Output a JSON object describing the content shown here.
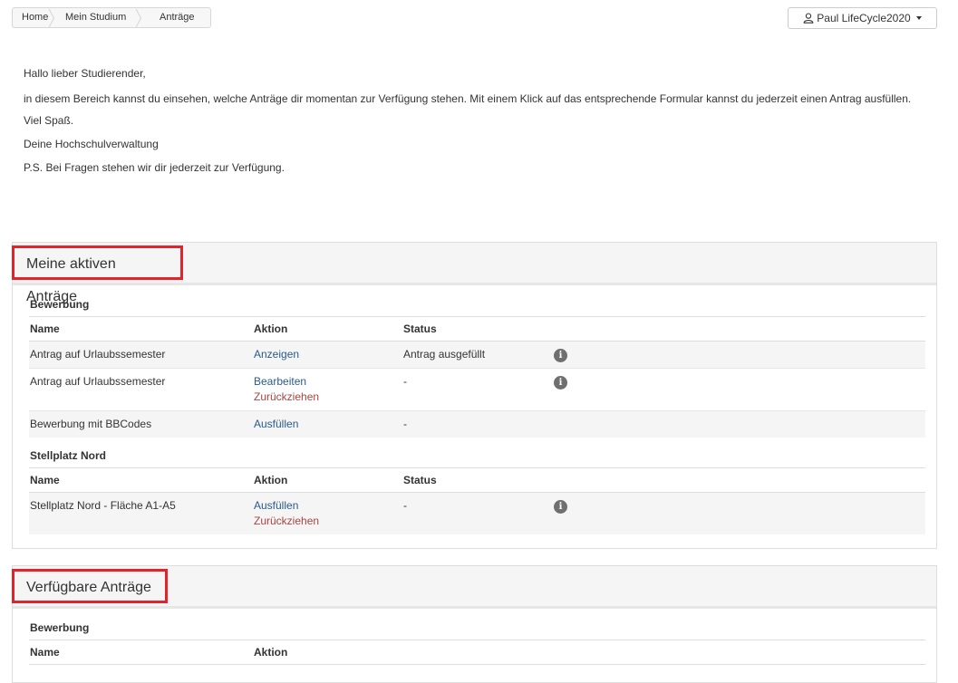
{
  "breadcrumb": [
    "Home",
    "Mein Studium",
    "Anträge"
  ],
  "user": {
    "name": "Paul LifeCycle2020",
    "icon": "user-icon"
  },
  "intro": {
    "greeting": "Hallo lieber Studierender,",
    "body": "in diesem Bereich kannst du einsehen, welche Anträge dir momentan zur Verfügung stehen. Mit einem Klick auf das entsprechende Formular kannst du jederzeit einen Antrag ausfüllen.",
    "fun": "Viel Spaß.",
    "sign": "Deine Hochschulverwaltung",
    "ps": "P.S. Bei Fragen stehen wir dir jederzeit zur Verfügung."
  },
  "active": {
    "title": "Meine aktiven Anträge",
    "columns": {
      "name": "Name",
      "action": "Aktion",
      "status": "Status"
    },
    "groups": [
      {
        "title": "Bewerbung",
        "rows": [
          {
            "name": "Antrag auf Urlaubssemester",
            "actions": [
              "Anzeigen"
            ],
            "status": "Antrag ausgefüllt",
            "info": "i"
          },
          {
            "name": "Antrag auf Urlaubssemester",
            "actions": [
              "Bearbeiten",
              "Zurückziehen"
            ],
            "status": "-",
            "info": "i"
          },
          {
            "name": "Bewerbung mit BBCodes",
            "actions": [
              "Ausfüllen"
            ],
            "status": "-"
          }
        ]
      },
      {
        "title": "Stellplatz Nord",
        "rows": [
          {
            "name": "Stellplatz Nord - Fläche A1-A5",
            "actions": [
              "Ausfüllen",
              "Zurückziehen"
            ],
            "status": "-",
            "info": "i"
          }
        ]
      }
    ]
  },
  "available": {
    "title": "Verfügbare Anträge",
    "columns": {
      "name": "Name",
      "action": "Aktion"
    },
    "groups": [
      {
        "title": "Bewerbung"
      }
    ]
  },
  "colors": {
    "link": "#2a5a8a",
    "danger": "#a94442",
    "highlight": "#e3222b"
  }
}
